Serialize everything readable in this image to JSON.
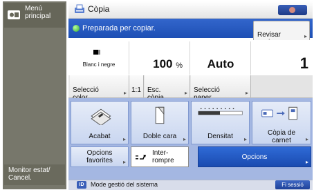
{
  "rail": {
    "main_menu_label": "Menú\nprincipal",
    "monitor_label": "Monitor estat/\nCancel."
  },
  "header": {
    "title": "Còpia"
  },
  "status": {
    "message": "Preparada per copiar.",
    "review_label": "Revisar\nopcions"
  },
  "info": {
    "color_mode": "Blanc i negre",
    "ratio_value": "100",
    "ratio_unit": "%",
    "paper": "Auto",
    "copies": "1"
  },
  "tabs": {
    "color": "Selecció\ncolor",
    "one_to_one": "1:1",
    "esc": "Esc.\ncòpia",
    "paper": "Selecció\npaper"
  },
  "functions": {
    "acabat": "Acabat",
    "doble_cara": "Doble cara",
    "densitat": "Densitat",
    "carnet": "Còpia de\ncarnet",
    "favorites": "Opcions\nfavorites",
    "interrompre": "Inter-\nrompre",
    "opcions": "Opcions"
  },
  "footer": {
    "id_badge": "ID",
    "mode_text": "Mode gestió del sistema",
    "logout_label": "Fi sessió"
  },
  "colors": {
    "rail": "#77776b",
    "status_blue": "#1d4fb4",
    "function_area": "#a4b7e2",
    "primary_button": "#2f6ad6"
  }
}
